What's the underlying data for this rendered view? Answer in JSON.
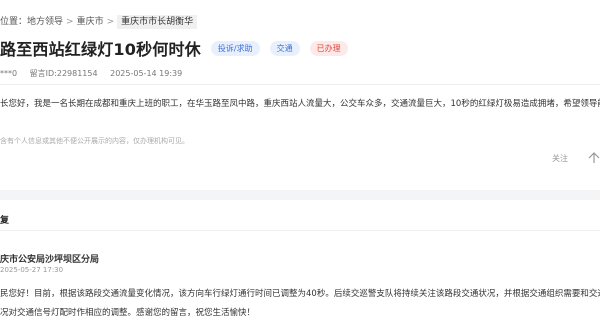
{
  "breadcrumb": {
    "prefix": "位置：",
    "items": [
      "地方领导",
      "重庆市",
      "重庆市市长胡衡华"
    ],
    "separator": ">"
  },
  "message": {
    "title": "路至西站红绿灯10秒何时休",
    "type_tag": "投诉/求助",
    "field_tag": "交通",
    "status_tag": "已办理",
    "user": "***0",
    "id_label": "留言ID:22981154",
    "date": "2025-05-14 19:39",
    "content": "长您好，我是一名长期在成都和重庆上班的职工，在华玉路至凤中路，重庆西站人流量大，公交车众多，交通流量巨大，10秒的红绿灯极易造成拥堵，希望领导能够",
    "note": "含有个人信息或其他不便公开展示的内容，仅办理机构可见。",
    "follow_label": "关注",
    "share_icon": "share-icon"
  },
  "reply": {
    "heading": "复",
    "department": "庆市公安局沙坪坝区分局",
    "date": "2025-05-27 17:30",
    "line1": "民您好！目前，根据该路段交通流量变化情况，该方向车行绿灯通行时间已调整为40秒。后续交巡警支队将持续关注该路段交通状况，并根据交通组织需要和交通流",
    "line2": "况对交通信号灯配时作相应的调整。感谢您的留言，祝您生活愉快！"
  },
  "colors": {
    "tag_blue": "#3a6fd8",
    "tag_red": "#e0463c"
  }
}
